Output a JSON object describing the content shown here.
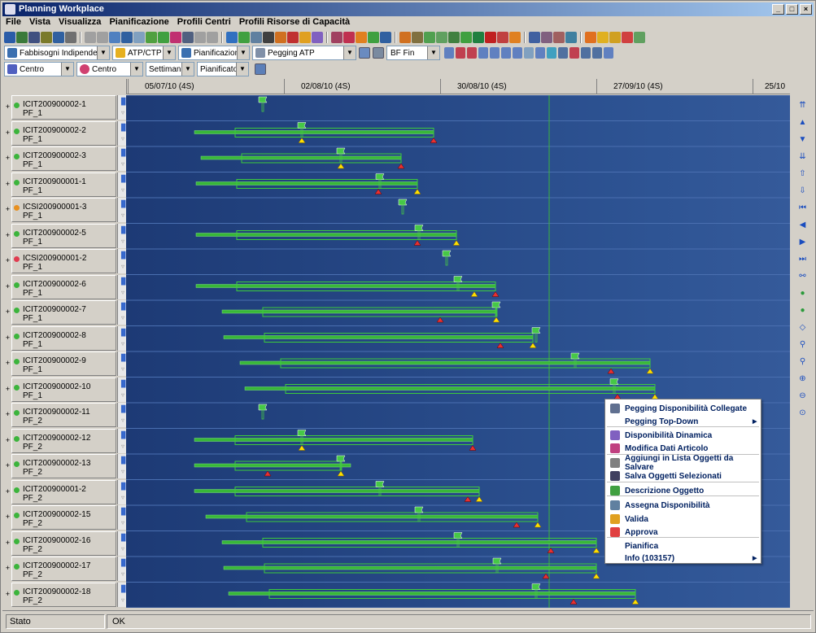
{
  "window": {
    "title": "Planning Workplace",
    "controls": [
      "_",
      "□",
      "×"
    ]
  },
  "menu": [
    "File",
    "Vista",
    "Visualizza",
    "Pianificazione",
    "Profili Centri",
    "Profili Risorse di Capacità"
  ],
  "toolbar3": {
    "combos": [
      {
        "label": "Fabbisogni Indipendenti",
        "icon_color": "#3a6fb0"
      },
      {
        "label": "ATP/CTP",
        "icon_color": "#e6b020"
      },
      {
        "label": "Pianificazione",
        "icon_color": "#3a6fb0"
      },
      {
        "label": "Pegging ATP",
        "icon_color": "#8090a8"
      }
    ],
    "combo_bf": "BF Fin"
  },
  "toolbar4": {
    "combos": [
      {
        "label": "Centro",
        "icon_color": "#5060c0"
      },
      {
        "label": "Centro",
        "icon_color": "#d04070"
      },
      {
        "label": "Settimana"
      },
      {
        "label": "Pianificato"
      }
    ]
  },
  "timeline": [
    "05/07/10 (4S)",
    "02/08/10 (4S)",
    "30/08/10 (4S)",
    "27/09/10 (4S)",
    "25/10"
  ],
  "rows": [
    {
      "name": "ICIT200900002-1",
      "sub": "PF_1",
      "status": "#3cb43c"
    },
    {
      "name": "ICIT200900002-2",
      "sub": "PF_1",
      "status": "#3cb43c"
    },
    {
      "name": "ICIT200900002-3",
      "sub": "PF_1",
      "status": "#3cb43c"
    },
    {
      "name": "ICIT200900001-1",
      "sub": "PF_1",
      "status": "#3cb43c"
    },
    {
      "name": "ICSI200900001-3",
      "sub": "PF_1",
      "status": "#e89020"
    },
    {
      "name": "ICIT200900002-5",
      "sub": "PF_1",
      "status": "#3cb43c"
    },
    {
      "name": "ICSI200900001-2",
      "sub": "PF_1",
      "status": "#e03c50"
    },
    {
      "name": "ICIT200900002-6",
      "sub": "PF_1",
      "status": "#3cb43c"
    },
    {
      "name": "ICIT200900002-7",
      "sub": "PF_1",
      "status": "#3cb43c"
    },
    {
      "name": "ICIT200900002-8",
      "sub": "PF_1",
      "status": "#3cb43c"
    },
    {
      "name": "ICIT200900002-9",
      "sub": "PF_1",
      "status": "#3cb43c"
    },
    {
      "name": "ICIT200900002-10",
      "sub": "PF_1",
      "status": "#3cb43c"
    },
    {
      "name": "ICIT200900002-11",
      "sub": "PF_2",
      "status": "#3cb43c"
    },
    {
      "name": "ICIT200900002-12",
      "sub": "PF_2",
      "status": "#3cb43c"
    },
    {
      "name": "ICIT200900002-13",
      "sub": "PF_2",
      "status": "#3cb43c"
    },
    {
      "name": "ICIT200900001-2",
      "sub": "PF_2",
      "status": "#3cb43c"
    },
    {
      "name": "ICIT200900002-15",
      "sub": "PF_2",
      "status": "#3cb43c"
    },
    {
      "name": "ICIT200900002-16",
      "sub": "PF_2",
      "status": "#3cb43c"
    },
    {
      "name": "ICIT200900002-17",
      "sub": "PF_2",
      "status": "#3cb43c"
    },
    {
      "name": "ICIT200900002-18",
      "sub": "PF_2",
      "status": "#3cb43c"
    }
  ],
  "gantt": {
    "rows": [
      {
        "start": null,
        "end": null,
        "flag": 168,
        "yellow": null,
        "red": null
      },
      {
        "start": 84,
        "end": 378,
        "flag": 216,
        "yellow": 216,
        "red": 378
      },
      {
        "start": 92,
        "end": 338,
        "flag": 264,
        "yellow": 264,
        "red": 338
      },
      {
        "start": 86,
        "end": 358,
        "flag": 312,
        "yellow": 358,
        "red": 310
      },
      {
        "start": null,
        "end": null,
        "flag": 340,
        "yellow": null,
        "red": null
      },
      {
        "start": 86,
        "end": 406,
        "flag": 360,
        "yellow": 406,
        "red": 358
      },
      {
        "start": null,
        "end": null,
        "flag": 394,
        "yellow": null,
        "red": null
      },
      {
        "start": 86,
        "end": 454,
        "flag": 408,
        "yellow": 428,
        "red": 454
      },
      {
        "start": 118,
        "end": 455,
        "flag": 455,
        "yellow": 455,
        "red": 386
      },
      {
        "start": 120,
        "end": 500,
        "flag": 504,
        "yellow": 500,
        "red": 460
      },
      {
        "start": 140,
        "end": 644,
        "flag": 552,
        "yellow": 644,
        "red": 596
      },
      {
        "start": 146,
        "end": 650,
        "flag": 600,
        "yellow": 650,
        "red": 604
      },
      {
        "start": null,
        "end": null,
        "flag": 168,
        "yellow": null,
        "red": null
      },
      {
        "start": 84,
        "end": 426,
        "flag": 216,
        "yellow": 216,
        "red": 426
      },
      {
        "start": 84,
        "end": 276,
        "flag": 264,
        "yellow": 264,
        "red": 174
      },
      {
        "start": 84,
        "end": 434,
        "flag": 312,
        "yellow": 434,
        "red": 420
      },
      {
        "start": 98,
        "end": 506,
        "flag": 360,
        "yellow": 506,
        "red": 480
      },
      {
        "start": 118,
        "end": 578,
        "flag": 408,
        "yellow": 578,
        "red": 522
      },
      {
        "start": 120,
        "end": 578,
        "flag": 456,
        "yellow": 578,
        "red": 516
      },
      {
        "start": 126,
        "end": 626,
        "flag": 504,
        "yellow": 626,
        "red": 550
      }
    ],
    "today_line": 520
  },
  "context_menu": {
    "items": [
      {
        "label": "Pegging Disponibilità Collegate",
        "icon": "pegging-icon",
        "icon_color": "#607090",
        "arrow": false
      },
      {
        "label": "Pegging Top-Down",
        "icon": "",
        "icon_color": "",
        "arrow": true
      },
      {
        "label": "Disponibilità Dinamica",
        "icon": "chart-icon",
        "icon_color": "#8060c0",
        "arrow": false
      },
      {
        "label": "Modifica Dati Articolo",
        "icon": "edit-icon",
        "icon_color": "#c04080",
        "arrow": false
      },
      {
        "label": "Aggiungi in Lista Oggetti da Salvare",
        "icon": "add-list-icon",
        "icon_color": "#808080",
        "arrow": false
      },
      {
        "label": "Salva Oggetti Selezionati",
        "icon": "save-icon",
        "icon_color": "#404060",
        "arrow": false
      },
      {
        "label": "Descrizione Oggetto",
        "icon": "info-icon",
        "icon_color": "#40a040",
        "arrow": false
      },
      {
        "label": "Assegna Disponibilità",
        "icon": "assign-icon",
        "icon_color": "#6080a0",
        "arrow": false
      },
      {
        "label": "Valida",
        "icon": "validate-icon",
        "icon_color": "#e0a020",
        "arrow": false
      },
      {
        "label": "Approva",
        "icon": "approve-icon",
        "icon_color": "#e04040",
        "arrow": false
      },
      {
        "label": "Pianifica",
        "icon": "",
        "icon_color": "",
        "arrow": false
      },
      {
        "label": "Info (103157)",
        "icon": "",
        "icon_color": "",
        "arrow": true
      }
    ]
  },
  "status": {
    "label": "Stato",
    "value": "OK"
  }
}
